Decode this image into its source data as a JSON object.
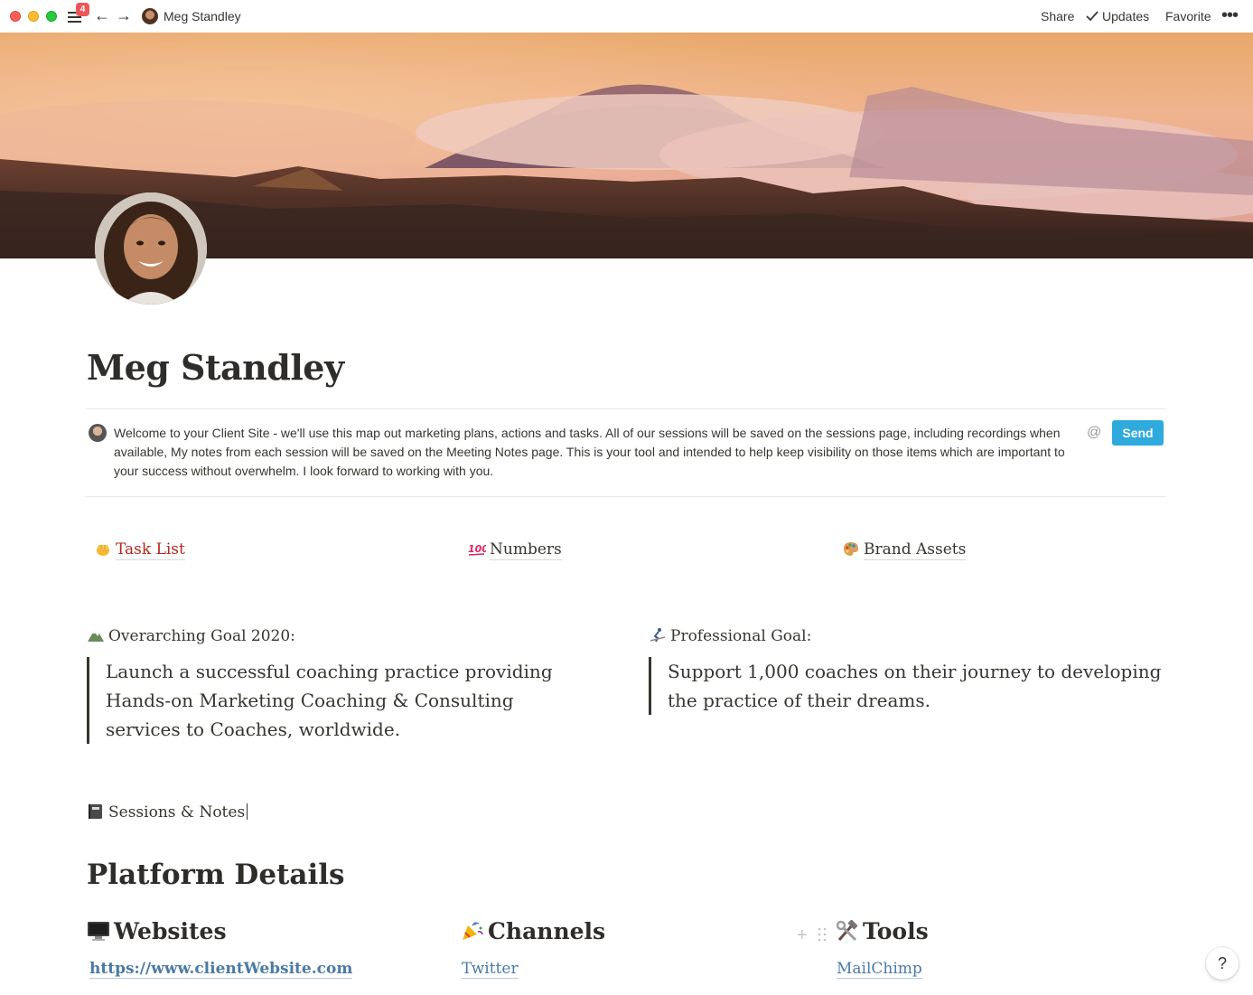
{
  "topbar": {
    "notification_count": "4",
    "back_arrow": "←",
    "forward_arrow": "→",
    "breadcrumb_title": "Meg Standley",
    "share_label": "Share",
    "updates_label": "Updates",
    "favorite_label": "Favorite",
    "more_label": "•••"
  },
  "page": {
    "title": "Meg Standley"
  },
  "comment": {
    "text": "Welcome to your Client Site - we'll use this map out marketing plans, actions and tasks. All of our sessions will be saved on the sessions page, including recordings when available,  My notes from each session will be saved on the Meeting Notes page.  This is your tool and intended to help keep visibility on those items which are important to your success without overwhelm.   I look forward to working with you.",
    "at_symbol": "@",
    "send_label": "Send"
  },
  "page_links": [
    {
      "label": "Task List",
      "icon": "fist-bump-icon",
      "color": "#b5271f"
    },
    {
      "label": "Numbers",
      "icon": "hundred-points-icon",
      "color": "#37352f"
    },
    {
      "label": "Brand Assets",
      "icon": "artist-palette-icon",
      "color": "#37352f"
    }
  ],
  "goals": {
    "overarching_heading": "Overarching Goal 2020:",
    "overarching_text": "Launch a successful coaching practice providing Hands-on Marketing Coaching & Consulting services to Coaches, worldwide.",
    "professional_heading": "Professional Goal:",
    "professional_text": "Support 1,000 coaches on their journey to developing the practice of their dreams."
  },
  "sessions_label": "Sessions & Notes",
  "platform": {
    "heading": "Platform Details",
    "websites_heading": "Websites",
    "websites_link": "https://www.clientWebsite.com",
    "channels_heading": "Channels",
    "channels_link": "Twitter",
    "tools_heading": "Tools",
    "tools_link": "MailChimp",
    "add_symbol": "+"
  },
  "help_label": "?"
}
